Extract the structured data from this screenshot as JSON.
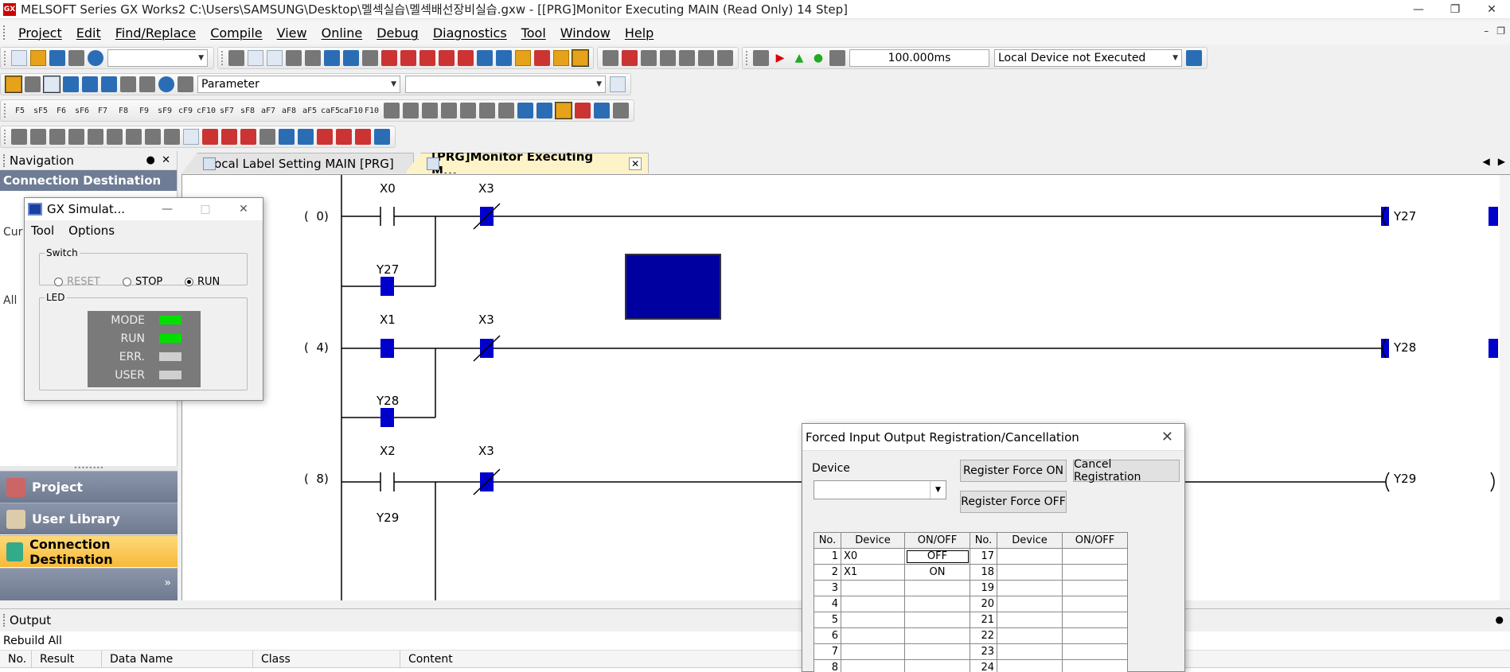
{
  "window": {
    "title": "MELSOFT Series GX Works2 C:\\Users\\SAMSUNG\\Desktop\\멜섹실습\\멜섹배선장비실습.gxw - [[PRG]Monitor Executing MAIN (Read Only) 14 Step]",
    "app_icon_text": "GX"
  },
  "menu": [
    "Project",
    "Edit",
    "Find/Replace",
    "Compile",
    "View",
    "Online",
    "Debug",
    "Diagnostics",
    "Tool",
    "Window",
    "Help"
  ],
  "toolbar": {
    "scan_time": "100.000ms",
    "device_status": "Local Device not Executed",
    "parameter_select": "Parameter",
    "ladder_keys": [
      "F5",
      "sF5",
      "F6",
      "sF6",
      "F7",
      "F8",
      "F9",
      "sF9",
      "cF9",
      "cF10",
      "sF7",
      "sF8",
      "aF7",
      "aF8",
      "aF5",
      "caF5",
      "caF10",
      "F10"
    ]
  },
  "navigation": {
    "title": "Navigation",
    "section_title": "Connection Destination",
    "current_label": "Cur",
    "all_label": "All",
    "buttons": [
      {
        "label": "Project"
      },
      {
        "label": "User Library"
      },
      {
        "label": "Connection Destination"
      }
    ],
    "more_chevron": "»"
  },
  "tabs": [
    {
      "label": "Local Label Setting MAIN [PRG]",
      "active": false
    },
    {
      "label": "[PRG]Monitor Executing M...",
      "active": true
    }
  ],
  "ladder": {
    "rungs": [
      {
        "step": "0",
        "contact1": "X0",
        "contact2": "X3",
        "branch": "Y27",
        "coil": "Y27"
      },
      {
        "step": "4",
        "contact1": "X1",
        "contact2": "X3",
        "branch": "Y28",
        "coil": "Y28"
      },
      {
        "step": "8",
        "contact1": "X2",
        "contact2": "X3",
        "branch": "Y29",
        "coil": "Y29"
      }
    ]
  },
  "simulator": {
    "title": "GX Simulat...",
    "menu": [
      "Tool",
      "Options"
    ],
    "switch_legend": "Switch",
    "switch_options": [
      {
        "label": "RESET",
        "checked": false,
        "disabled": true
      },
      {
        "label": "STOP",
        "checked": false,
        "disabled": false
      },
      {
        "label": "RUN",
        "checked": true,
        "disabled": false
      }
    ],
    "led_legend": "LED",
    "leds": [
      {
        "label": "MODE",
        "on": true
      },
      {
        "label": "RUN",
        "on": true
      },
      {
        "label": "ERR.",
        "on": false
      },
      {
        "label": "USER",
        "on": false
      }
    ]
  },
  "forced_io": {
    "title": "Forced Input Output Registration/Cancellation",
    "device_label": "Device",
    "device_value": "",
    "buttons": {
      "register_on": "Register Force ON",
      "register_off": "Register Force OFF",
      "cancel": "Cancel Registration"
    },
    "headers": [
      "No.",
      "Device",
      "ON/OFF",
      "No.",
      "Device",
      "ON/OFF"
    ],
    "rows": [
      {
        "no": "1",
        "device": "X0",
        "state": "OFF",
        "no2": "17",
        "device2": "",
        "state2": ""
      },
      {
        "no": "2",
        "device": "X1",
        "state": "ON",
        "no2": "18",
        "device2": "",
        "state2": ""
      },
      {
        "no": "3",
        "device": "",
        "state": "",
        "no2": "19",
        "device2": "",
        "state2": ""
      },
      {
        "no": "4",
        "device": "",
        "state": "",
        "no2": "20",
        "device2": "",
        "state2": ""
      },
      {
        "no": "5",
        "device": "",
        "state": "",
        "no2": "21",
        "device2": "",
        "state2": ""
      },
      {
        "no": "6",
        "device": "",
        "state": "",
        "no2": "22",
        "device2": "",
        "state2": ""
      },
      {
        "no": "7",
        "device": "",
        "state": "",
        "no2": "23",
        "device2": "",
        "state2": ""
      },
      {
        "no": "8",
        "device": "",
        "state": "",
        "no2": "24",
        "device2": "",
        "state2": ""
      }
    ]
  },
  "output": {
    "title": "Output",
    "sub": "Rebuild All",
    "columns": [
      "No.",
      "Result",
      "Data Name",
      "Class",
      "Content"
    ]
  },
  "colors": {
    "energized": "#0000cc",
    "nav_active": "#f6b93b",
    "led_on": "#00e000"
  }
}
